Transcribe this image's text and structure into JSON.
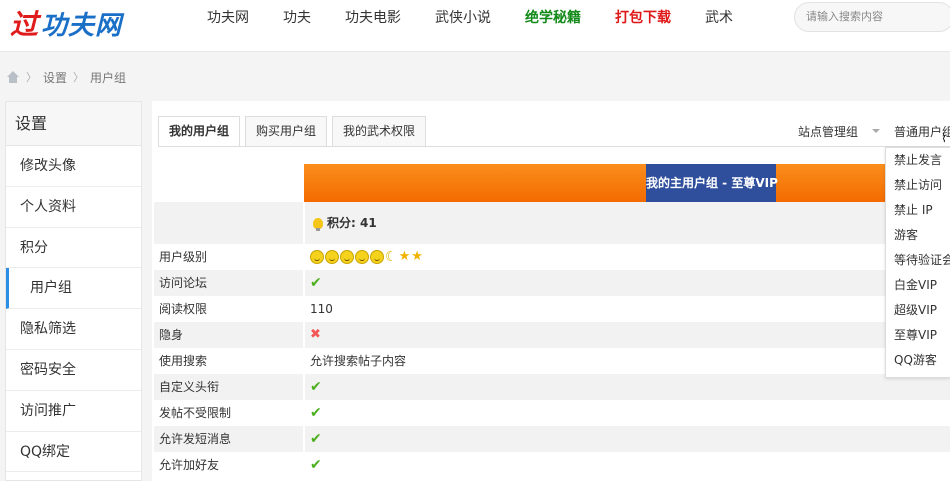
{
  "header": {
    "logo_mark": "过",
    "logo_text": "功夫网",
    "nav": [
      {
        "label": "功夫网",
        "style": "normal"
      },
      {
        "label": "功夫",
        "style": "normal"
      },
      {
        "label": "功夫电影",
        "style": "normal"
      },
      {
        "label": "武侠小说",
        "style": "normal"
      },
      {
        "label": "绝学秘籍",
        "style": "green"
      },
      {
        "label": "打包下载",
        "style": "red"
      },
      {
        "label": "武术",
        "style": "normal"
      }
    ],
    "search_placeholder": "请输入搜索内容"
  },
  "breadcrumb": {
    "items": [
      "设置",
      "用户组"
    ],
    "separator": "〉"
  },
  "sidebar": {
    "title": "设置",
    "items": [
      {
        "label": "修改头像",
        "active": false
      },
      {
        "label": "个人资料",
        "active": false
      },
      {
        "label": "积分",
        "active": false
      },
      {
        "label": "用户组",
        "active": true
      },
      {
        "label": "隐私筛选",
        "active": false
      },
      {
        "label": "密码安全",
        "active": false
      },
      {
        "label": "访问推广",
        "active": false
      },
      {
        "label": "QQ绑定",
        "active": false
      }
    ]
  },
  "main": {
    "tabs": [
      {
        "label": "我的用户组",
        "active": true
      },
      {
        "label": "购买用户组",
        "active": false
      },
      {
        "label": "我的武术权限",
        "active": false
      }
    ],
    "site_admin_group": "站点管理组",
    "normal_user_group": "普通用户组",
    "banner_title": "我的主用户组 - 至尊VIP",
    "score_label": "积分: 41",
    "rows": [
      {
        "key": "用户级别",
        "type": "level",
        "value": ""
      },
      {
        "key": "访问论坛",
        "type": "check",
        "value": ""
      },
      {
        "key": "阅读权限",
        "type": "text",
        "value": "110"
      },
      {
        "key": "隐身",
        "type": "cross",
        "value": ""
      },
      {
        "key": "使用搜索",
        "type": "text",
        "value": "允许搜索帖子内容"
      },
      {
        "key": "自定义头衔",
        "type": "check",
        "value": ""
      },
      {
        "key": "发帖不受限制",
        "type": "check",
        "value": ""
      },
      {
        "key": "允许发短消息",
        "type": "check",
        "value": ""
      },
      {
        "key": "允许加好友",
        "type": "check",
        "value": ""
      }
    ],
    "level_icons": [
      "smile-icon",
      "smile-icon",
      "smile-icon",
      "smile-icon",
      "smile-icon",
      "moon-icon",
      "star-icon",
      "star-icon"
    ]
  },
  "dropdown": {
    "items": [
      "禁止发言",
      "禁止访问",
      "禁止 IP",
      "游客",
      "等待验证会员",
      "白金VIP",
      "超级VIP",
      "至尊VIP",
      "QQ游客"
    ]
  },
  "colors": {
    "banner_orange": "#f36b00",
    "banner_title_bg": "#2f4f9d",
    "active_accent": "#2b8de3",
    "nav_green": "#138a1a",
    "nav_red": "#e01717"
  }
}
